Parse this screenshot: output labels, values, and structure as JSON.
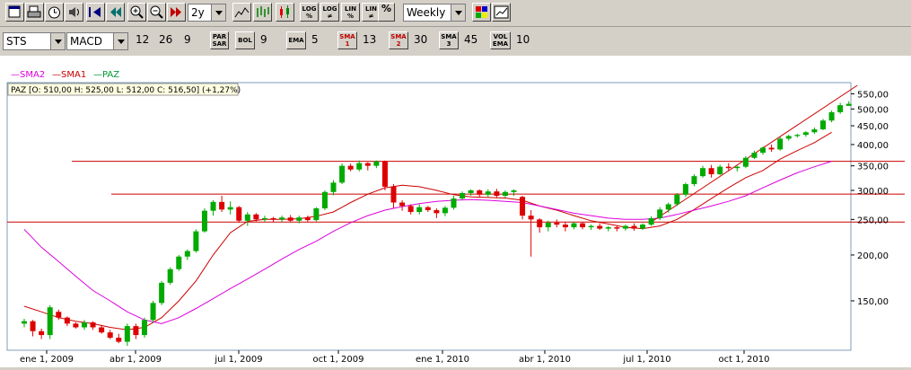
{
  "toolbar1": {
    "period": "2y",
    "frequency": "Weekly",
    "log_labels": [
      "LOG\n%",
      "LOG\n≠",
      "LIN\n%",
      "LIN\n≠"
    ],
    "pct_label": "%"
  },
  "toolbar2": {
    "symbol": "STS",
    "indicator": "MACD",
    "macd_params": [
      "12",
      "26",
      "9"
    ],
    "parsar_label": "PAR SAR",
    "bol_label": "BOL",
    "bol_param": "9",
    "ema_label": "EMA",
    "ema_param": "5",
    "sma1_label": "SMA 1",
    "sma1_param": "13",
    "sma2_label": "SMA 2",
    "sma2_param": "30",
    "sma3_label": "SMA 3",
    "sma3_param": "45",
    "volema_label": "VOL EMA",
    "volema_param": "10"
  },
  "legend": {
    "sma2": "—SMA2",
    "sma1": "—SMA1",
    "paz": "—PAZ"
  },
  "info": "PAZ [O: 510,00  H: 525,00  L: 512,00  C: 516,50] (+1,27%)",
  "colors": {
    "up": "#00aa00",
    "down": "#dd0000",
    "sma1": "#cc0000",
    "sma2": "#dd00dd",
    "paz": "#009933",
    "hline": "#cc0000"
  },
  "chart_data": {
    "type": "candlestick",
    "title": "",
    "y_scale": "log",
    "ylim": [
      110,
      590
    ],
    "y_ticks": [
      "550,00",
      "500,00",
      "450,00",
      "400,00",
      "350,00",
      "300,00",
      "250,00",
      "200,00",
      "150,00"
    ],
    "x_ticks": [
      "ene 1, 2009",
      "abr 1, 2009",
      "jul 1, 2009",
      "oct 1, 2009",
      "ene 1, 2010",
      "abr 1, 2010",
      "jul 1, 2010",
      "oct 1, 2010"
    ],
    "horizontal_lines": [
      360,
      293,
      246
    ],
    "last_bar": {
      "open": 510,
      "high": 525,
      "low": 512,
      "close": 516.5
    },
    "ohlc": [
      [
        130,
        134,
        127,
        132
      ],
      [
        132,
        133,
        120,
        124
      ],
      [
        124,
        126,
        118,
        121
      ],
      [
        121,
        146,
        118,
        144
      ],
      [
        140,
        142,
        133,
        135
      ],
      [
        135,
        136,
        128,
        130
      ],
      [
        130,
        131,
        126,
        127
      ],
      [
        127,
        133,
        125,
        131
      ],
      [
        131,
        132,
        125,
        127
      ],
      [
        127,
        129,
        122,
        123
      ],
      [
        123,
        125,
        118,
        119
      ],
      [
        119,
        122,
        115,
        116
      ],
      [
        116,
        130,
        113,
        128
      ],
      [
        128,
        130,
        118,
        121
      ],
      [
        121,
        135,
        119,
        133
      ],
      [
        133,
        150,
        131,
        148
      ],
      [
        148,
        170,
        146,
        168
      ],
      [
        168,
        185,
        166,
        183
      ],
      [
        183,
        200,
        181,
        198
      ],
      [
        198,
        207,
        194,
        205
      ],
      [
        205,
        235,
        203,
        232
      ],
      [
        232,
        268,
        230,
        264
      ],
      [
        264,
        282,
        256,
        279
      ],
      [
        279,
        290,
        262,
        266
      ],
      [
        266,
        280,
        258,
        270
      ],
      [
        270,
        272,
        245,
        248
      ],
      [
        248,
        262,
        240,
        258
      ],
      [
        258,
        260,
        247,
        250
      ],
      [
        250,
        256,
        246,
        252
      ],
      [
        252,
        254,
        246,
        250
      ],
      [
        250,
        256,
        246,
        253
      ],
      [
        253,
        257,
        246,
        248
      ],
      [
        248,
        256,
        244,
        253
      ],
      [
        253,
        256,
        246,
        249
      ],
      [
        249,
        270,
        247,
        268
      ],
      [
        268,
        300,
        265,
        297
      ],
      [
        297,
        320,
        291,
        315
      ],
      [
        315,
        355,
        312,
        350
      ],
      [
        350,
        355,
        338,
        342
      ],
      [
        342,
        362,
        338,
        356
      ],
      [
        356,
        358,
        340,
        350
      ],
      [
        350,
        362,
        345,
        360
      ],
      [
        360,
        362,
        300,
        307
      ],
      [
        307,
        312,
        268,
        278
      ],
      [
        278,
        282,
        264,
        272
      ],
      [
        272,
        275,
        258,
        262
      ],
      [
        262,
        275,
        258,
        270
      ],
      [
        270,
        272,
        262,
        265
      ],
      [
        265,
        268,
        252,
        260
      ],
      [
        260,
        272,
        255,
        269
      ],
      [
        269,
        290,
        266,
        285
      ],
      [
        285,
        298,
        283,
        295
      ],
      [
        295,
        302,
        290,
        300
      ],
      [
        300,
        302,
        288,
        292
      ],
      [
        292,
        302,
        288,
        298
      ],
      [
        298,
        303,
        286,
        290
      ],
      [
        290,
        300,
        287,
        297
      ],
      [
        297,
        302,
        290,
        300
      ],
      [
        288,
        290,
        250,
        256
      ],
      [
        256,
        265,
        198,
        250
      ],
      [
        250,
        252,
        230,
        238
      ],
      [
        238,
        248,
        232,
        245
      ],
      [
        245,
        250,
        238,
        242
      ],
      [
        242,
        246,
        232,
        238
      ],
      [
        238,
        246,
        235,
        244
      ],
      [
        244,
        246,
        235,
        238
      ],
      [
        238,
        242,
        234,
        240
      ],
      [
        240,
        244,
        234,
        236
      ],
      [
        236,
        240,
        232,
        238
      ],
      [
        238,
        240,
        232,
        236
      ],
      [
        236,
        242,
        233,
        240
      ],
      [
        240,
        244,
        233,
        236
      ],
      [
        236,
        244,
        234,
        242
      ],
      [
        242,
        255,
        240,
        252
      ],
      [
        252,
        270,
        249,
        266
      ],
      [
        266,
        278,
        261,
        275
      ],
      [
        275,
        295,
        272,
        292
      ],
      [
        292,
        315,
        288,
        312
      ],
      [
        312,
        332,
        308,
        328
      ],
      [
        328,
        350,
        325,
        345
      ],
      [
        345,
        352,
        325,
        332
      ],
      [
        332,
        352,
        330,
        348
      ],
      [
        348,
        356,
        340,
        345
      ],
      [
        345,
        350,
        338,
        348
      ],
      [
        348,
        372,
        345,
        368
      ],
      [
        368,
        385,
        365,
        380
      ],
      [
        380,
        395,
        375,
        392
      ],
      [
        392,
        400,
        382,
        388
      ],
      [
        388,
        420,
        385,
        415
      ],
      [
        415,
        425,
        410,
        422
      ],
      [
        422,
        428,
        418,
        425
      ],
      [
        425,
        435,
        420,
        432
      ],
      [
        432,
        445,
        428,
        440
      ],
      [
        440,
        470,
        438,
        465
      ],
      [
        465,
        495,
        460,
        490
      ],
      [
        490,
        520,
        485,
        512
      ],
      [
        510,
        525,
        512,
        516.5
      ]
    ],
    "series": [
      {
        "name": "SMA1",
        "points": [
          [
            0,
            145
          ],
          [
            2,
            140
          ],
          [
            4,
            135
          ],
          [
            6,
            132
          ],
          [
            8,
            130
          ],
          [
            10,
            127
          ],
          [
            12,
            125
          ],
          [
            14,
            127
          ],
          [
            16,
            135
          ],
          [
            18,
            150
          ],
          [
            20,
            170
          ],
          [
            22,
            200
          ],
          [
            24,
            230
          ],
          [
            26,
            247
          ],
          [
            28,
            250
          ],
          [
            30,
            250
          ],
          [
            32,
            251
          ],
          [
            34,
            255
          ],
          [
            36,
            262
          ],
          [
            38,
            278
          ],
          [
            40,
            293
          ],
          [
            42,
            305
          ],
          [
            44,
            310
          ],
          [
            46,
            307
          ],
          [
            48,
            300
          ],
          [
            50,
            292
          ],
          [
            52,
            288
          ],
          [
            54,
            287
          ],
          [
            56,
            286
          ],
          [
            58,
            282
          ],
          [
            60,
            272
          ],
          [
            62,
            265
          ],
          [
            64,
            256
          ],
          [
            66,
            248
          ],
          [
            68,
            243
          ],
          [
            70,
            238
          ],
          [
            72,
            236
          ],
          [
            74,
            240
          ],
          [
            76,
            250
          ],
          [
            78,
            266
          ],
          [
            80,
            285
          ],
          [
            82,
            305
          ],
          [
            84,
            325
          ],
          [
            86,
            340
          ],
          [
            88,
            365
          ],
          [
            90,
            385
          ],
          [
            92,
            405
          ],
          [
            94,
            432
          ]
        ]
      },
      {
        "name": "SMA2",
        "points": [
          [
            0,
            235
          ],
          [
            2,
            210
          ],
          [
            4,
            192
          ],
          [
            6,
            175
          ],
          [
            8,
            160
          ],
          [
            10,
            150
          ],
          [
            12,
            140
          ],
          [
            14,
            133
          ],
          [
            16,
            130
          ],
          [
            18,
            135
          ],
          [
            20,
            143
          ],
          [
            22,
            152
          ],
          [
            24,
            162
          ],
          [
            26,
            172
          ],
          [
            28,
            183
          ],
          [
            30,
            195
          ],
          [
            32,
            207
          ],
          [
            34,
            218
          ],
          [
            36,
            232
          ],
          [
            38,
            245
          ],
          [
            40,
            256
          ],
          [
            42,
            265
          ],
          [
            44,
            271
          ],
          [
            46,
            276
          ],
          [
            48,
            280
          ],
          [
            50,
            282
          ],
          [
            52,
            283
          ],
          [
            54,
            282
          ],
          [
            56,
            280
          ],
          [
            58,
            278
          ],
          [
            60,
            272
          ],
          [
            62,
            266
          ],
          [
            64,
            260
          ],
          [
            66,
            256
          ],
          [
            68,
            252
          ],
          [
            70,
            250
          ],
          [
            72,
            250
          ],
          [
            74,
            252
          ],
          [
            76,
            258
          ],
          [
            78,
            265
          ],
          [
            80,
            272
          ],
          [
            82,
            280
          ],
          [
            84,
            290
          ],
          [
            86,
            305
          ],
          [
            88,
            320
          ],
          [
            90,
            335
          ],
          [
            92,
            348
          ],
          [
            94,
            360
          ]
        ]
      },
      {
        "name": "PAZ trend",
        "points": [
          [
            73,
            246
          ],
          [
            97,
            580
          ]
        ]
      }
    ]
  }
}
